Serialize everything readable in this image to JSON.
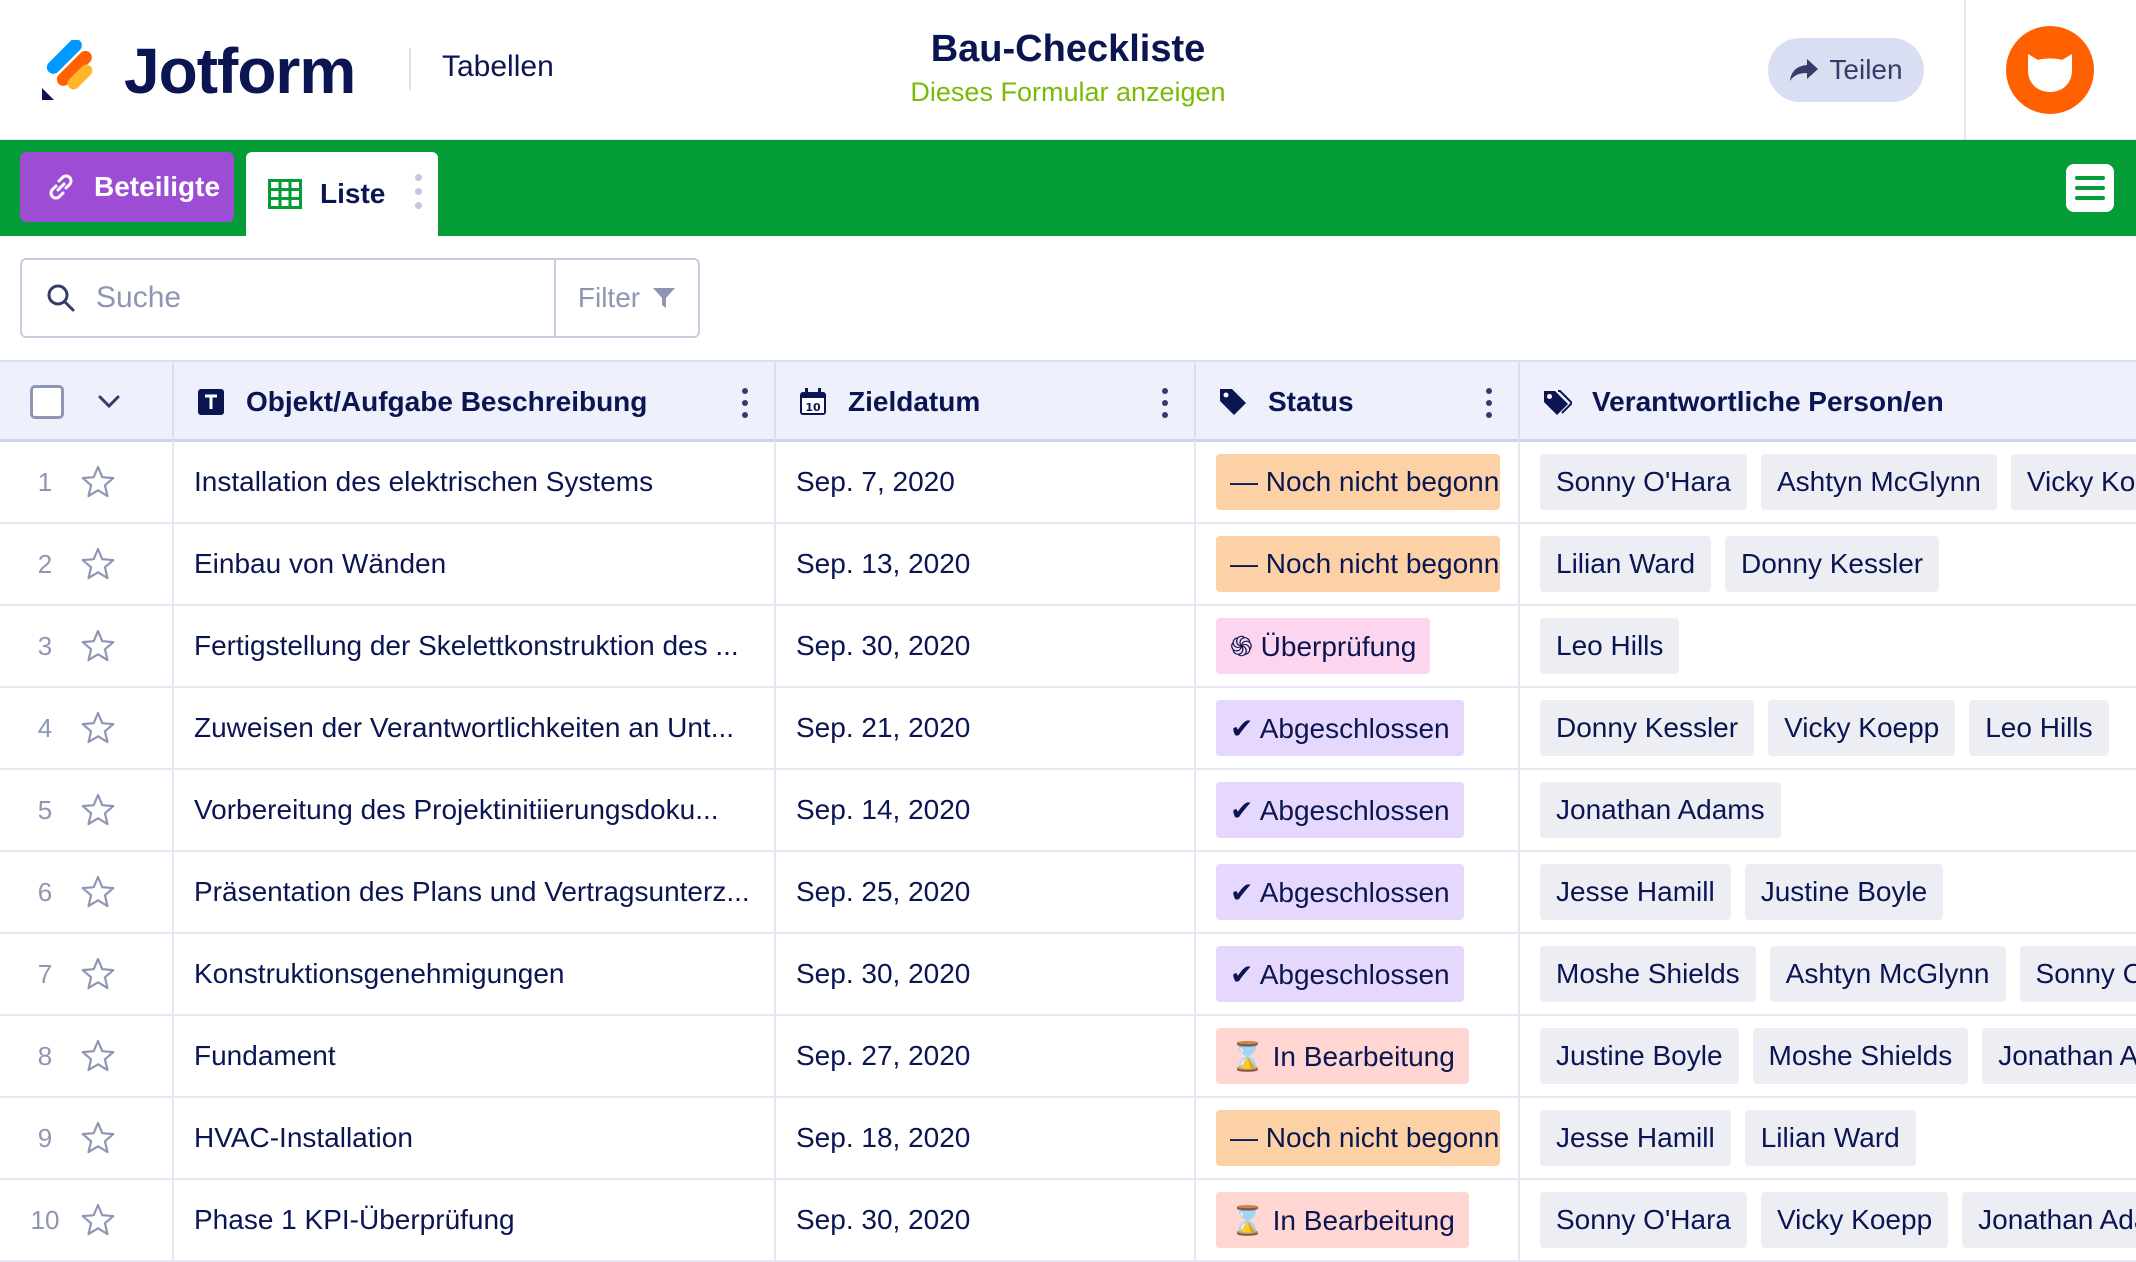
{
  "header": {
    "brand": "Jotform",
    "section": "Tabellen",
    "title": "Bau-Checkliste",
    "form_link": "Dieses Formular anzeigen",
    "share_label": "Teilen"
  },
  "tabs": {
    "participants_label": "Beteiligte",
    "list_label": "Liste"
  },
  "search": {
    "placeholder": "Suche",
    "filter_label": "Filter"
  },
  "table": {
    "columns": [
      {
        "label": "Objekt/Aufgabe Beschreibung",
        "icon": "text-type-icon"
      },
      {
        "label": "Zieldatum",
        "icon": "calendar-icon"
      },
      {
        "label": "Status",
        "icon": "tag-icon"
      },
      {
        "label": "Verantwortliche Person/en",
        "icon": "tags-icon"
      }
    ],
    "rows": [
      {
        "num": "1",
        "desc": "Installation des elektrischen Systems",
        "date": "Sep. 7, 2020",
        "status": "— Noch nicht begonnen",
        "people": [
          "Sonny O'Hara",
          "Ashtyn McGlynn",
          "Vicky Koepp"
        ]
      },
      {
        "num": "2",
        "desc": "Einbau von Wänden",
        "date": "Sep. 13, 2020",
        "status": "— Noch nicht begonnen",
        "people": [
          "Lilian Ward",
          "Donny Kessler"
        ]
      },
      {
        "num": "3",
        "desc": "Fertigstellung der Skelettkonstruktion des ...",
        "date": "Sep. 30, 2020",
        "status": "֍ Überprüfung",
        "people": [
          "Leo Hills"
        ]
      },
      {
        "num": "4",
        "desc": "Zuweisen der Verantwortlichkeiten an Unt...",
        "date": "Sep. 21, 2020",
        "status": "✔ Abgeschlossen",
        "people": [
          "Donny Kessler",
          "Vicky Koepp",
          "Leo Hills"
        ]
      },
      {
        "num": "5",
        "desc": "Vorbereitung des Projektinitiierungsdoku...",
        "date": "Sep. 14, 2020",
        "status": "✔ Abgeschlossen",
        "people": [
          "Jonathan Adams"
        ]
      },
      {
        "num": "6",
        "desc": "Präsentation des Plans und Vertragsunterz...",
        "date": "Sep. 25, 2020",
        "status": "✔ Abgeschlossen",
        "people": [
          "Jesse Hamill",
          "Justine Boyle"
        ]
      },
      {
        "num": "7",
        "desc": "Konstruktionsgenehmigungen",
        "date": "Sep. 30, 2020",
        "status": "✔ Abgeschlossen",
        "people": [
          "Moshe Shields",
          "Ashtyn McGlynn",
          "Sonny O'Hara"
        ]
      },
      {
        "num": "8",
        "desc": "Fundament",
        "date": "Sep. 27, 2020",
        "status": "⌛ In Bearbeitung",
        "people": [
          "Justine Boyle",
          "Moshe Shields",
          "Jonathan Adams"
        ]
      },
      {
        "num": "9",
        "desc": "HVAC-Installation",
        "date": "Sep. 18, 2020",
        "status": "— Noch nicht begonnen",
        "people": [
          "Jesse Hamill",
          "Lilian Ward"
        ]
      },
      {
        "num": "10",
        "desc": "Phase 1 KPI-Überprüfung",
        "date": "Sep. 30, 2020",
        "status": "⌛ In Bearbeitung",
        "people": [
          "Sonny O'Hara",
          "Vicky Koepp",
          "Jonathan Adams"
        ]
      }
    ],
    "status_colors": {
      "not_started": "#fcd1a6",
      "review": "#fcd5ef",
      "done": "#e6d8fc",
      "in_progress": "#ffd6d1"
    }
  },
  "colors": {
    "brand_navy": "#0a1551",
    "toolbar_green": "#039c36",
    "participants_purple": "#9c4dd3",
    "form_link_green": "#78bb07",
    "avatar_orange": "#ff6100"
  }
}
